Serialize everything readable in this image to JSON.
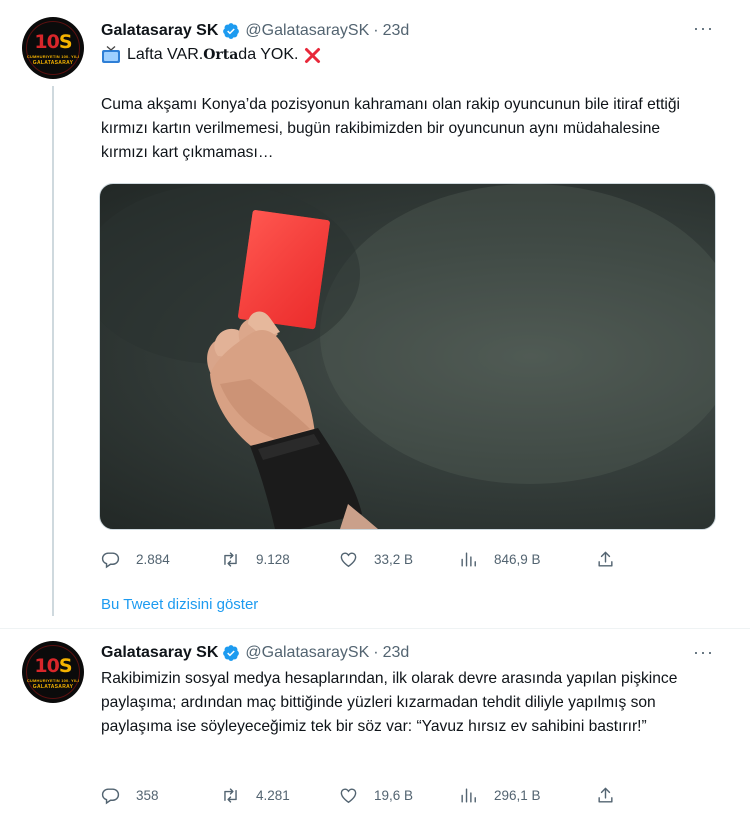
{
  "tweets": [
    {
      "author": {
        "name": "Galatasaray SK",
        "handle": "@GalatasaraySK",
        "time": "23d",
        "avatar_number": "1",
        "avatar_number_2": "2",
        "avatar_number_3": "0",
        "avatar_line1": "CUMHURIYETIN 100. YILI",
        "avatar_line2": "GALATASARAY"
      },
      "headline": {
        "part1": "Lafta VAR. ",
        "part2": "Orta",
        "part3": "da YOK."
      },
      "text": "Cuma akşamı Konya’da pozisyonun kahramanı olan rakip oyuncunun bile itiraf ettiği kırmızı kartın verilmemesi, bugün rakibimizden bir oyuncunun aynı müdahalesine kırmızı kart çıkmaması…",
      "metrics": {
        "replies": "2.884",
        "retweets": "9.128",
        "likes": "33,2 B",
        "views": "846,9 B"
      }
    },
    {
      "author": {
        "name": "Galatasaray SK",
        "handle": "@GalatasaraySK",
        "time": "23d",
        "avatar_number": "1",
        "avatar_number_2": "2",
        "avatar_number_3": "0",
        "avatar_line1": "CUMHURIYETIN 100. YILI",
        "avatar_line2": "GALATASARAY"
      },
      "text": "Rakibimizin sosyal medya hesaplarından, ilk olarak devre arasında yapılan pişkince paylaşıma; ardından maç bittiğinde yüzleri kızarmadan tehdit diliyle yapılmış son paylaşıma ise söyleyeceğimiz tek bir söz var: “Yavuz hırsız ev sahibini bastırır!”",
      "metrics": {
        "replies": "358",
        "retweets": "4.281",
        "likes": "19,6 B",
        "views": "296,1 B"
      }
    }
  ],
  "show_thread": "Bu Tweet dizisini göster",
  "colors": {
    "link": "#1d9bf0",
    "muted": "#536471",
    "verified": "#1d9bf0",
    "red_card": "#ff3b3b"
  },
  "icons": [
    "verified-badge-icon",
    "tv-icon",
    "red-x-icon",
    "reply-icon",
    "retweet-icon",
    "like-icon",
    "views-icon",
    "share-icon",
    "more-icon"
  ]
}
